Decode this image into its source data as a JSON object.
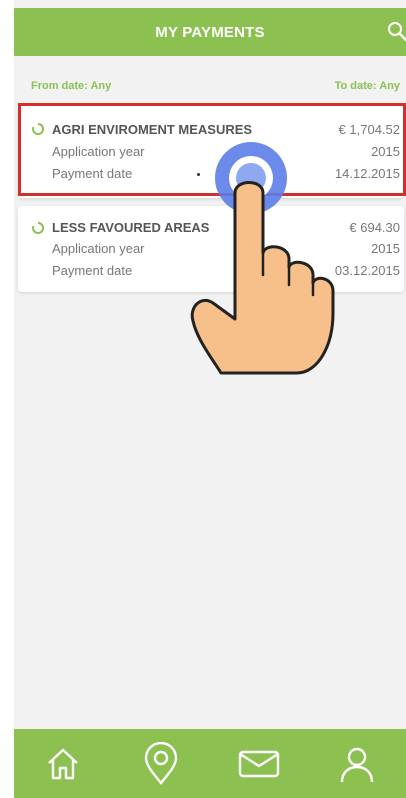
{
  "header": {
    "title": "MY PAYMENTS"
  },
  "filters": {
    "from": "From date: Any",
    "to": "To date: Any"
  },
  "payments": [
    {
      "title": "AGRI ENVIROMENT MEASURES",
      "amount": "€ 1,704.52",
      "app_year_label": "Application year",
      "app_year_value": "2015",
      "pay_date_label": "Payment date",
      "pay_date_value": "14.12.2015"
    },
    {
      "title": "LESS FAVOURED AREAS",
      "amount": "€ 694.30",
      "app_year_label": "Application year",
      "app_year_value": "2015",
      "pay_date_label": "Payment date",
      "pay_date_value": "03.12.2015"
    }
  ],
  "nav": [
    "home-icon",
    "location-icon",
    "mail-icon",
    "profile-icon"
  ],
  "colors": {
    "brand": "#8cc152",
    "highlight": "#d32f2f",
    "tap": "#5b7de8"
  }
}
